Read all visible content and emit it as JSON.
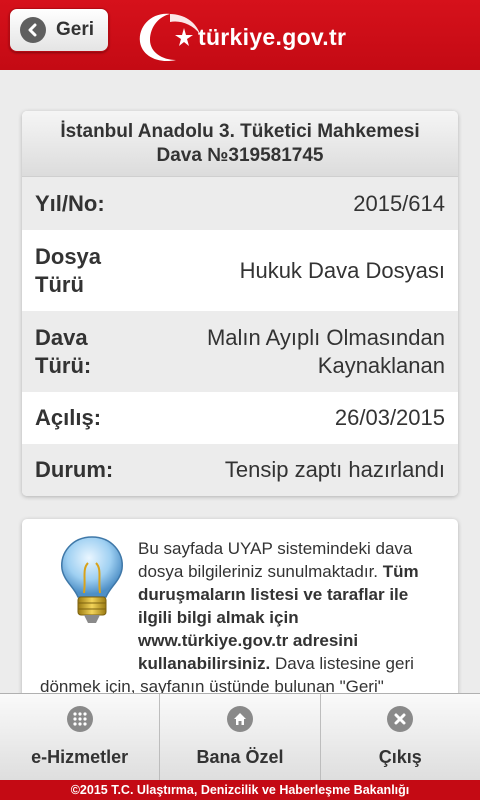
{
  "header": {
    "back_label": "Geri",
    "logo_text": "türkiye.gov.tr"
  },
  "case": {
    "title_line1": "İstanbul Anadolu 3. Tüketici Mahkemesi",
    "title_line2": "Dava №319581745",
    "rows": [
      {
        "label": "Yıl/No:",
        "value": "2015/614"
      },
      {
        "label_lines": [
          "Dosya",
          "Türü"
        ],
        "value": "Hukuk Dava Dosyası"
      },
      {
        "label_lines": [
          "Dava",
          "Türü:"
        ],
        "value_lines": [
          "Malın Ayıplı Olmasından",
          "Kaynaklanan"
        ]
      },
      {
        "label": "Açılış:",
        "value": "26/03/2015"
      },
      {
        "label": "Durum:",
        "value": "Tensip zaptı hazırlandı"
      }
    ]
  },
  "info": {
    "icon": "lightbulb-icon",
    "text_plain1": "Bu sayfada UYAP sistemindeki dava dosya bilgileriniz sunulmaktadır. ",
    "text_bold": "Tüm duruşmaların listesi ve taraflar ile ilgili bilgi almak için www.türkiye.gov.tr adresini kullanabilirsiniz.",
    "text_plain2": " Dava listesine geri dönmek için, sayfanın üstünde bulunan \"Geri\""
  },
  "bottom_nav": [
    {
      "label": "e-Hizmetler",
      "icon": "grid-icon"
    },
    {
      "label": "Bana Özel",
      "icon": "home-icon"
    },
    {
      "label": "Çıkış",
      "icon": "close-icon"
    }
  ],
  "footer": {
    "copyright": "©2015 T.C. Ulaştırma, Denizcilik ve Haberleşme Bakanlığı"
  },
  "colors": {
    "brand_red": "#c40a14",
    "icon_gray": "#8a8a8a"
  }
}
